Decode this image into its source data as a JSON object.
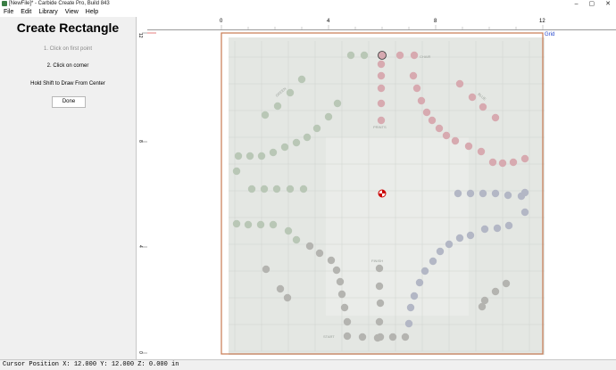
{
  "window": {
    "title": "[NewFile]* - Carbide Create Pro, Build 843",
    "controls": [
      "–",
      "▢",
      "✕"
    ]
  },
  "menu": [
    "File",
    "Edit",
    "Library",
    "View",
    "Help"
  ],
  "panel": {
    "title": "Create Rectangle",
    "step1": "1. Click on first point",
    "step2": "2. Click on corner",
    "hint": "Hold Shift to Draw From Center",
    "done_label": "Done"
  },
  "rulers": {
    "x_ticks": [
      "0",
      "4",
      "8",
      "12"
    ],
    "y_ticks": [
      "12",
      "8",
      "4",
      "0"
    ]
  },
  "grid_label": "Grid",
  "board_labels": [
    "CHAIR",
    "PRINTS",
    "BLUE",
    "GREEN",
    "FINISH",
    "START"
  ],
  "status": {
    "cursor": "Cursor Position  X: 12.000  Y: 12.000  Z: 0.000  in"
  },
  "colors": {
    "outline": "#c77a52",
    "origin": "#d00000",
    "grid_label": "#2244cc",
    "peg_green": "#b9c7b6",
    "peg_red": "#d7aab0",
    "peg_blue": "#b3b7c5",
    "peg_gray": "#b4b4b0"
  }
}
